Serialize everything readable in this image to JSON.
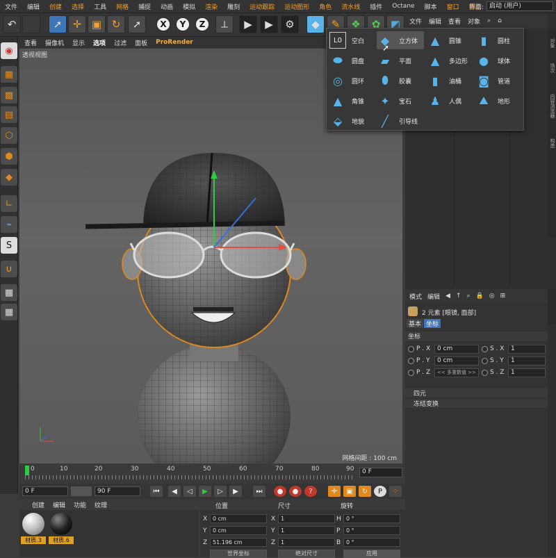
{
  "menubar": {
    "items": [
      "文件",
      "编辑",
      "创建",
      "选择",
      "工具",
      "网格",
      "捕捉",
      "动画",
      "模拟",
      "渲染",
      "雕刻",
      "运动跟踪",
      "运动图形",
      "角色",
      "流水线",
      "插件",
      "Octane",
      "脚本",
      "窗口",
      "帮助"
    ],
    "layout_label": "界面:",
    "layout_value": "启动 (用户)"
  },
  "viewport_menu": {
    "items": [
      "查看",
      "摄像机",
      "显示",
      "选项",
      "过滤",
      "面板"
    ],
    "prorender": "ProRender"
  },
  "viewport": {
    "title": "透视视图",
    "grid_spacing": "网格间距 : 100 cm"
  },
  "timeline": {
    "ticks": [
      "0",
      "10",
      "20",
      "30",
      "40",
      "50",
      "60",
      "70",
      "80",
      "90"
    ],
    "frame": "0 F"
  },
  "playbar": {
    "current_frame": "0 F",
    "end_frame": "90 F"
  },
  "materials": {
    "menu": [
      "创建",
      "编辑",
      "功能",
      "纹理"
    ],
    "items": [
      "材质.3",
      "材质.6"
    ]
  },
  "coords": {
    "headers": [
      "位置",
      "尺寸",
      "旋转"
    ],
    "rows": [
      {
        "axis": "X",
        "pos": "0 cm",
        "size": "1",
        "rlabel": "H",
        "rot": "0 °"
      },
      {
        "axis": "Y",
        "pos": "0 cm",
        "size": "1",
        "rlabel": "P",
        "rot": "0 °"
      },
      {
        "axis": "Z",
        "pos": "51.196 cm",
        "size": "1",
        "rlabel": "B",
        "rot": "0 °"
      }
    ],
    "buttons": [
      "世界坐标",
      "绝对尺寸",
      "应用"
    ]
  },
  "object_manager": {
    "menu": [
      "文件",
      "编辑",
      "查看",
      "对象"
    ]
  },
  "side_tabs": [
    "对象",
    "场次",
    "内容浏览器",
    "构造"
  ],
  "attributes": {
    "menu": [
      "模式",
      "编辑"
    ],
    "title": "2 元素 [眼镜, 面部]",
    "tabs": [
      "基本",
      "坐标"
    ],
    "section": "坐标",
    "rows": [
      {
        "l1": "P . X",
        "v1": "0 cm",
        "l2": "S . X",
        "v2": "1"
      },
      {
        "l1": "P . Y",
        "v1": "0 cm",
        "l2": "S . Y",
        "v2": "1"
      },
      {
        "l1": "P . Z",
        "v1": "<< 多重数值 >>",
        "l2": "S . Z",
        "v2": "1"
      }
    ],
    "groups": [
      "四元",
      "冻结变换"
    ]
  },
  "popup": {
    "items": [
      {
        "label": "空白",
        "icon": "null-icon"
      },
      {
        "label": "立方体",
        "icon": "cube-icon"
      },
      {
        "label": "圆锥",
        "icon": "cone-icon"
      },
      {
        "label": "圆柱",
        "icon": "cylinder-icon"
      },
      {
        "label": "圆盘",
        "icon": "disc-icon"
      },
      {
        "label": "平面",
        "icon": "plane-icon"
      },
      {
        "label": "多边形",
        "icon": "polygon-icon"
      },
      {
        "label": "球体",
        "icon": "sphere-icon"
      },
      {
        "label": "圆环",
        "icon": "torus-icon"
      },
      {
        "label": "胶囊",
        "icon": "capsule-icon"
      },
      {
        "label": "油桶",
        "icon": "oiltank-icon"
      },
      {
        "label": "管道",
        "icon": "tube-icon"
      },
      {
        "label": "角锥",
        "icon": "pyramid-icon"
      },
      {
        "label": "宝石",
        "icon": "platonic-icon"
      },
      {
        "label": "人偶",
        "icon": "figure-icon"
      },
      {
        "label": "地形",
        "icon": "landscape-icon"
      },
      {
        "label": "地貌",
        "icon": "relief-icon"
      },
      {
        "label": "引导线",
        "icon": "guide-icon"
      }
    ]
  },
  "colors": {
    "accent": "#f0a030",
    "selected": "#3e74b8",
    "icon_blue": "#58b4e8"
  }
}
